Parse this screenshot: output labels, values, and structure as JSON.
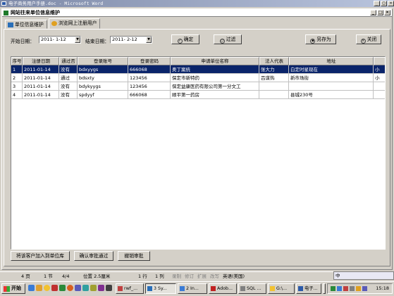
{
  "word_window": {
    "title": "电子商务用户手册.doc - Microsoft Word"
  },
  "app_window": {
    "title": "网站往来单位信息维护"
  },
  "tabs": [
    {
      "label": "单位信息维护",
      "active": false
    },
    {
      "label": "浏览网上注册用户",
      "active": true
    }
  ],
  "filters": {
    "start_label": "开始日期：",
    "start_value": "2011- 1-12",
    "end_label": "结束日期：",
    "end_value": "2011- 2-12"
  },
  "toolbar": {
    "confirm": "确定",
    "filter": "过滤",
    "save_as": "另存为",
    "close": "关闭"
  },
  "grid": {
    "columns": [
      "序号",
      "注册日期",
      "通过否",
      "登录账号",
      "登录密码",
      "申请单位名称",
      "法人代表",
      "地址",
      ""
    ],
    "rows": [
      [
        "1",
        "2011-01-14",
        "没有",
        "bdxyygs",
        "666068",
        "奥丁案统",
        "张大力",
        "白定时星现在",
        "小"
      ],
      [
        "2",
        "2011-01-14",
        "通过",
        "bdsxty",
        "123456",
        "保定市新特药",
        "吕谋热",
        "新市场街",
        "小"
      ],
      [
        "3",
        "2011-01-14",
        "没有",
        "bdykyygs",
        "123456",
        "保定益康医药有限公司第一分文工",
        "",
        "",
        ""
      ],
      [
        "4",
        "2011-01-14",
        "没有",
        "spdyyf",
        "666068",
        "顺平第一药房",
        "",
        "县城230号",
        ""
      ]
    ],
    "selected_row": 0
  },
  "bottom_buttons": {
    "add_to_library": "将该客户加入到单位库",
    "approve": "确认审批通过",
    "revoke": "撤销审批"
  },
  "status_bar": {
    "page": "4 页",
    "section": "1 节",
    "pages": "4/4",
    "position": "位置 2.5厘米",
    "line": "1 行",
    "column": "1 列",
    "rec": "录制",
    "trk": "修订",
    "ext": "扩展",
    "ovr": "改写",
    "language": "英语(美国)"
  },
  "taskbar": {
    "start": "开始",
    "tasks": [
      "rwf_...",
      "3 Sy...",
      "2 In...",
      "Adob...",
      "SQL ...",
      "G:\\...",
      "电子...",
      "",
      ""
    ],
    "clock": "15:18"
  },
  "ime": {
    "label": "中"
  },
  "colors": {
    "selection": "#0a246a",
    "face": "#d4d0c8"
  }
}
